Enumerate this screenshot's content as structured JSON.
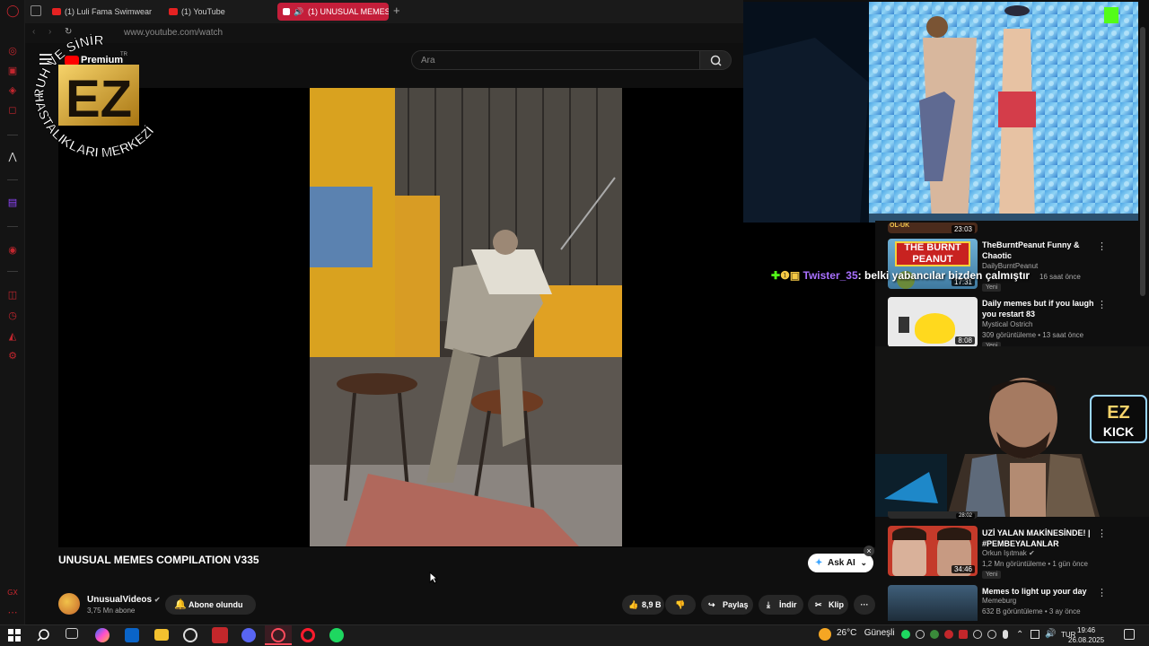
{
  "browser": {
    "tabs": [
      {
        "label": "(1) Luli Fama Swimwear F"
      },
      {
        "label": "(1) YouTube"
      },
      {
        "label": "(1) UNUSUAL MEMES"
      }
    ],
    "new_tab": "+",
    "url": "www.youtube.com/watch"
  },
  "youtube": {
    "brand": "Premium",
    "brand_sup": "TR",
    "search_placeholder": "Ara"
  },
  "overlay_logo": {
    "top_text": "RUH VE SİNİR",
    "bottom_text": "HASTALIKLARI MERKEZİ",
    "letters": "EZ"
  },
  "video": {
    "title": "UNUSUAL MEMES COMPILATION V335",
    "channel": "UnusualVideos",
    "subscribers": "3,75 Mn abone",
    "subscribe_label": "Abone olundu",
    "likes": "8,9 B",
    "share": "Paylaş",
    "download": "İndir",
    "clip": "Klip",
    "more": "···",
    "ask_ai": "Ask AI",
    "close": "×"
  },
  "chat": {
    "user": "Twister_35",
    "message": ": belki yabancılar bizden çalmıştır"
  },
  "recommendations": [
    {
      "title": "TheBurntPeanut Funny & Chaotic",
      "channel": "DailyBurntPeanut",
      "meta": "16 saat önce",
      "badge": "Yeni",
      "duration": "17:31",
      "thumb_text": "THE BURNT PEANUT"
    },
    {
      "title": "Daily memes but if you laugh you restart 83",
      "channel": "Mystical Ostrich",
      "meta": "309 görüntüleme • 13 saat önce",
      "badge": "Yeni",
      "duration": "8:08"
    },
    {
      "title": "UZİ YALAN MAKİNESİNDE! | #PEMBEYALANLAR",
      "channel": "Orkun Işıtmak",
      "meta": "1,2 Mn görüntüleme • 1 gün önce",
      "badge": "Yeni",
      "duration": "34:46"
    },
    {
      "title": "Memes to light up your day",
      "channel": "Memeburg",
      "meta": "632 B görüntüleme • 3 ay önce",
      "badge": "",
      "duration": ""
    }
  ],
  "rec_durations_partial": [
    "23:03",
    "28:02"
  ],
  "rec_top_text": "OL-UK",
  "webcam_badge": {
    "top": "EZ",
    "bottom": "KICK"
  },
  "taskbar": {
    "temperature": "26°C",
    "weather": "Güneşli",
    "lang": "TUR",
    "time": "19:46",
    "date": "26.08.2025"
  }
}
